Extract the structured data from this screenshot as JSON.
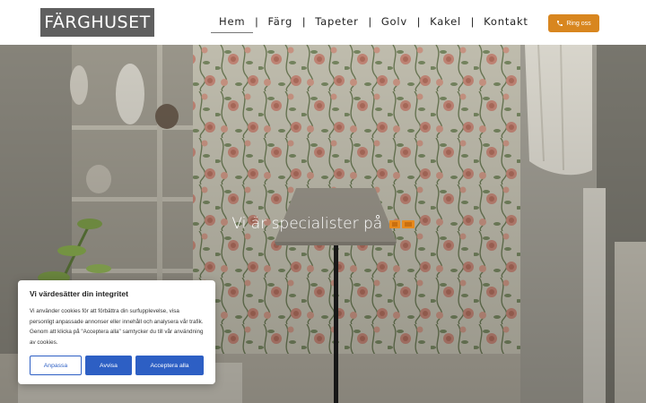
{
  "header": {
    "logo_text": "FÄRGHUSET",
    "nav": [
      {
        "label": "Hem",
        "active": true
      },
      {
        "label": "Färg",
        "active": false
      },
      {
        "label": "Tapeter",
        "active": false
      },
      {
        "label": "Golv",
        "active": false
      },
      {
        "label": "Kakel",
        "active": false
      },
      {
        "label": "Kontakt",
        "active": false
      }
    ],
    "separator": "|",
    "call_button": {
      "label": "Ring oss",
      "icon": "phone-icon"
    }
  },
  "hero": {
    "heading": "Vi är specialister på",
    "brand_logo": "bg-logo",
    "image": "floral-wallpaper-room-with-lamp"
  },
  "cookie": {
    "title": "Vi värdesätter din integritet",
    "text": "Vi använder cookies för att förbättra din surfupplevelse, visa personligt anpassade annonser eller innehåll och analysera vår trafik. Genom att klicka på \"Acceptera alla\" samtycker du till vår användning av cookies.",
    "buttons": {
      "customize": "Anpassa",
      "reject": "Avvisa",
      "accept": "Acceptera alla"
    }
  },
  "colors": {
    "accent": "#d8861f",
    "logo_bg": "#5f5f5f",
    "cookie_blue": "#2d5fc4"
  }
}
